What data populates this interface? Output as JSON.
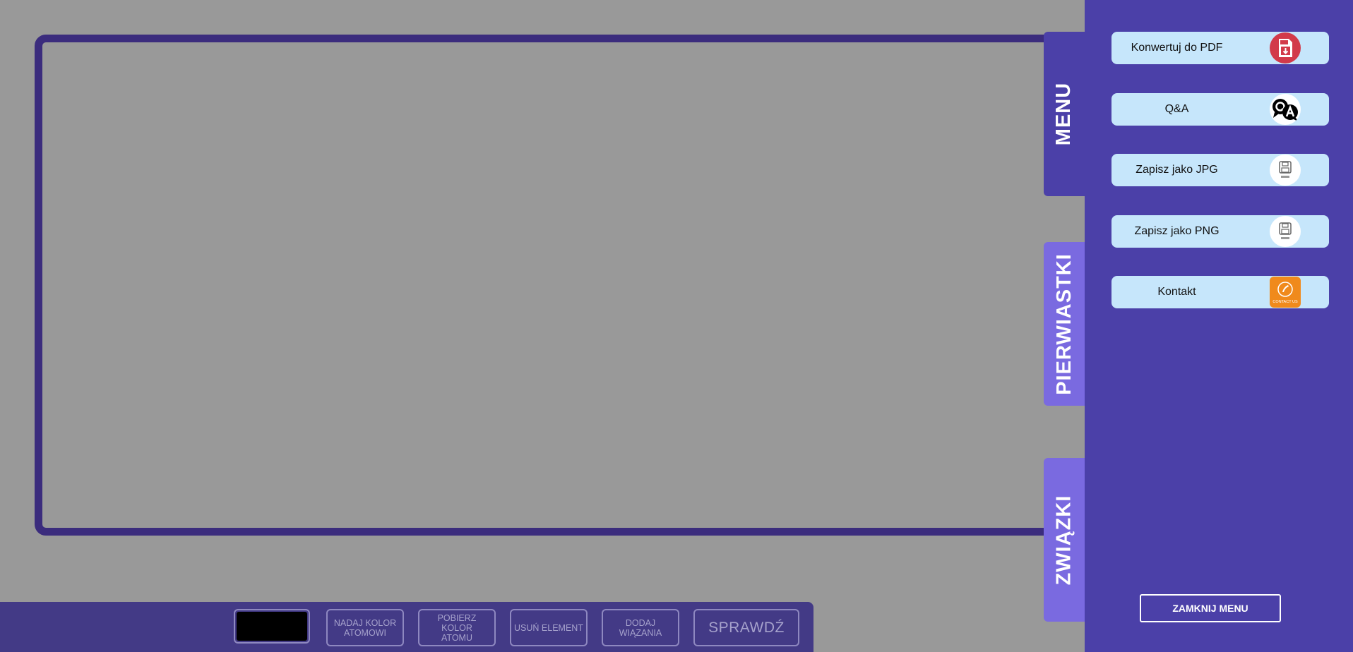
{
  "toolbar": {
    "color_swatch": "#000000",
    "buttons": [
      "NADAJ KOLOR\nATOMOWI",
      "POBIERZ KOLOR\nATOMU",
      "USUŃ ELEMENT",
      "DODAJ WIĄZANIA",
      "SPRAWDŹ"
    ]
  },
  "tabs": {
    "menu": "MENU",
    "elements": "PIERWIASTKI",
    "compounds": "ZWIĄZKI"
  },
  "menu": {
    "items": [
      {
        "label": "Konwertuj do PDF",
        "icon": "pdf-download-icon"
      },
      {
        "label": "Q&A",
        "icon": "qa-icon"
      },
      {
        "label": "Zapisz jako JPG",
        "icon": "save-icon"
      },
      {
        "label": "Zapisz jako PNG",
        "icon": "save-icon"
      },
      {
        "label": "Kontakt",
        "icon": "contact-icon"
      }
    ],
    "close_label": "ZAMKNIJ MENU",
    "contact_icon_text": "CONTACT US"
  },
  "colors": {
    "panel": "#4b40a8",
    "frame": "#3b2c7d",
    "tab_light": "#7a6ae0",
    "menu_item_bg": "#c6e6fb"
  }
}
